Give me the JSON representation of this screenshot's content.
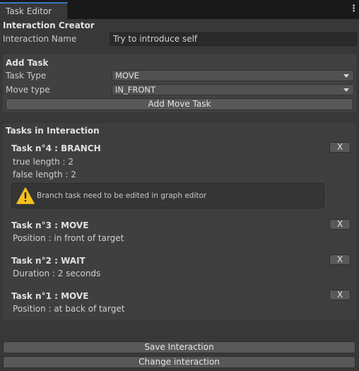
{
  "tab": {
    "title": "Task Editor"
  },
  "interaction_creator": {
    "title": "Interaction Creator",
    "name_label": "Interaction Name",
    "name_value": "Try to introduce self"
  },
  "add_task": {
    "title": "Add Task",
    "task_type_label": "Task Type",
    "task_type_value": "MOVE",
    "move_type_label": "Move type",
    "move_type_value": "IN_FRONT",
    "add_button": "Add Move Task"
  },
  "tasks_section": {
    "title": "Tasks in Interaction",
    "tasks": [
      {
        "title": "Task n°4 : BRANCH",
        "lines": [
          "true length : 2",
          "false length : 2"
        ],
        "help": "Branch task need to be edited in graph editor",
        "remove": "X"
      },
      {
        "title": "Task n°3 : MOVE",
        "lines": [
          "Position : in front of target"
        ],
        "remove": "X"
      },
      {
        "title": "Task n°2 : WAIT",
        "lines": [
          "Duration : 2 seconds"
        ],
        "remove": "X"
      },
      {
        "title": "Task n°1 : MOVE",
        "lines": [
          "Position : at back of target"
        ],
        "remove": "X"
      }
    ]
  },
  "footer": {
    "save_button": "Save Interaction",
    "change_button": "Change interaction"
  },
  "icons": {
    "menu": "kebab-icon",
    "warning": "warning-icon",
    "dropdown": "chevron-down-icon"
  },
  "colors": {
    "panel": "#383838",
    "tab_accent": "#3a79bb",
    "warning": "#f4c21a"
  }
}
